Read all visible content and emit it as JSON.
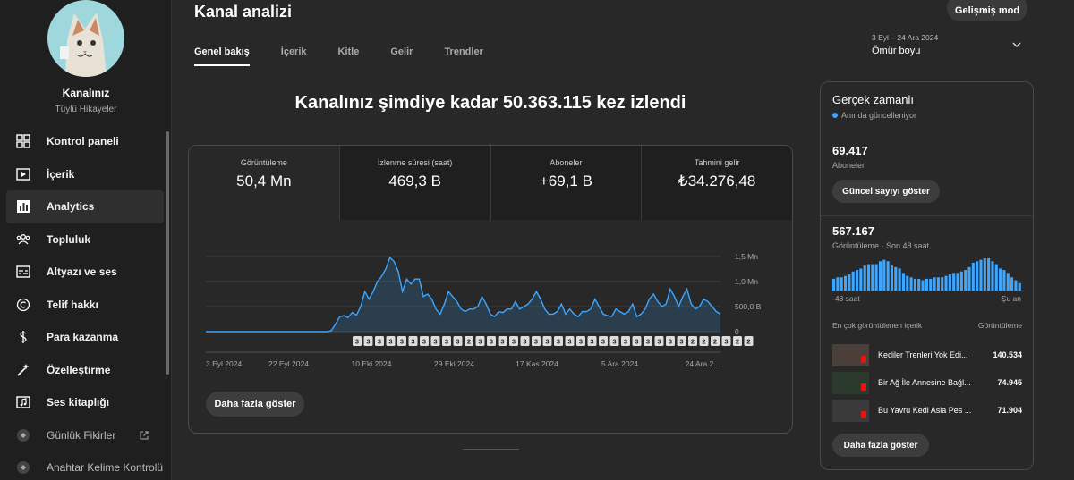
{
  "sidebar": {
    "channel_name": "Kanalınız",
    "channel_subtitle": "Tüylü Hikayeler",
    "items": [
      {
        "label": "Kontrol paneli",
        "icon": "dashboard-icon"
      },
      {
        "label": "İçerik",
        "icon": "content-icon"
      },
      {
        "label": "Analytics",
        "icon": "analytics-icon",
        "active": true
      },
      {
        "label": "Topluluk",
        "icon": "community-icon"
      },
      {
        "label": "Altyazı ve ses",
        "icon": "subtitles-icon"
      },
      {
        "label": "Telif hakkı",
        "icon": "copyright-icon"
      },
      {
        "label": "Para kazanma",
        "icon": "monetization-icon"
      },
      {
        "label": "Özelleştirme",
        "icon": "customization-icon"
      },
      {
        "label": "Ses kitaplığı",
        "icon": "audio-library-icon"
      },
      {
        "label": "Günlük Fikirler",
        "icon": "extension-icon"
      },
      {
        "label": "Anahtar Kelime Kontrolü",
        "icon": "extension-icon"
      }
    ]
  },
  "header": {
    "title": "Kanal analizi",
    "advanced_button": "Gelişmiş mod",
    "tabs": [
      "Genel bakış",
      "İçerik",
      "Kitle",
      "Gelir",
      "Trendler"
    ],
    "date_range": "3 Eyl – 24 Ara 2024",
    "date_label": "Ömür boyu"
  },
  "headline": "Kanalınız şimdiye kadar 50.363.115 kez izlendi",
  "metrics": [
    {
      "label": "Görüntüleme",
      "value": "50,4 Mn"
    },
    {
      "label": "İzlenme süresi (saat)",
      "value": "469,3 B"
    },
    {
      "label": "Aboneler",
      "value": "+69,1 B"
    },
    {
      "label": "Tahmini gelir",
      "value": "₺34.276,48"
    }
  ],
  "chart_data": {
    "type": "area",
    "x_labels": [
      "3 Eyl 2024",
      "22 Eyl 2024",
      "10 Eki 2024",
      "29 Eki 2024",
      "17 Kas 2024",
      "5 Ara 2024",
      "24 Ara 2..."
    ],
    "y_ticks": [
      "1,5 Mn",
      "1,0 Mn",
      "500,0 B",
      "0"
    ],
    "ylim": [
      0,
      1500000
    ],
    "values": [
      0,
      0,
      0,
      0,
      0,
      0,
      0,
      0,
      0,
      0,
      0,
      0,
      0,
      0,
      0,
      0,
      0,
      0,
      0,
      0,
      0,
      0,
      0,
      0,
      0,
      0,
      0,
      0,
      0,
      0,
      20000,
      150000,
      300000,
      320000,
      280000,
      380000,
      330000,
      500000,
      800000,
      650000,
      800000,
      1000000,
      1100000,
      1250000,
      1480000,
      1400000,
      1200000,
      800000,
      1050000,
      950000,
      1050000,
      1050000,
      700000,
      750000,
      650000,
      450000,
      350000,
      550000,
      800000,
      700000,
      600000,
      450000,
      400000,
      450000,
      450000,
      500000,
      700000,
      550000,
      350000,
      300000,
      400000,
      380000,
      450000,
      450000,
      600000,
      450000,
      500000,
      550000,
      650000,
      800000,
      650000,
      450000,
      350000,
      350000,
      400000,
      550000,
      350000,
      450000,
      350000,
      300000,
      400000,
      400000,
      450000,
      650000,
      500000,
      350000,
      320000,
      300000,
      450000,
      400000,
      350000,
      400000,
      550000,
      300000,
      350000,
      450000,
      650000,
      750000,
      600000,
      500000,
      550000,
      850000,
      700000,
      500000,
      700000,
      850000,
      550000,
      450000,
      500000,
      650000,
      600000,
      500000,
      400000,
      350000
    ],
    "markers": [
      "3",
      "3",
      "3",
      "3",
      "3",
      "3",
      "3",
      "3",
      "3",
      "3",
      "2",
      "3",
      "3",
      "3",
      "3",
      "3",
      "3",
      "3",
      "3",
      "3",
      "3",
      "3",
      "3",
      "3",
      "3",
      "3",
      "3",
      "3",
      "3",
      "3",
      "2",
      "2",
      "2",
      "3",
      "2",
      "2"
    ],
    "grid": true,
    "color": "#3ea6ff"
  },
  "card": {
    "more_button": "Daha fazla göster"
  },
  "realtime": {
    "title": "Gerçek zamanlı",
    "subtitle": "Anında güncelleniyor",
    "subscribers": "69.417",
    "subscribers_label": "Aboneler",
    "show_count_button": "Güncel sayıyı göster",
    "views": "567.167",
    "views_label": "Görüntüleme · Son 48 saat",
    "bar_values": [
      8,
      9,
      9,
      10,
      11,
      13,
      14,
      15,
      17,
      18,
      18,
      18,
      20,
      21,
      20,
      17,
      16,
      15,
      12,
      10,
      9,
      8,
      8,
      7,
      8,
      8,
      9,
      9,
      9,
      10,
      11,
      12,
      12,
      13,
      14,
      16,
      19,
      20,
      21,
      22,
      22,
      20,
      18,
      15,
      14,
      12,
      9,
      7,
      5
    ],
    "axis_left": "-48 saat",
    "axis_right": "Şu an",
    "top_content_header": "En çok görüntülenen içerik",
    "top_content_col": "Görüntüleme",
    "rows": [
      {
        "title": "Kediler Trenleri Yok Edi...",
        "views": "140.534"
      },
      {
        "title": "Bir Ağ İle Annesine Bağl...",
        "views": "74.945"
      },
      {
        "title": "Bu Yavru Kedi Asla Pes ...",
        "views": "71.904"
      }
    ],
    "more_button": "Daha fazla göster"
  },
  "colors": {
    "accent": "#3ea6ff",
    "bg": "#282828",
    "sidebar": "#1f1f1f"
  }
}
